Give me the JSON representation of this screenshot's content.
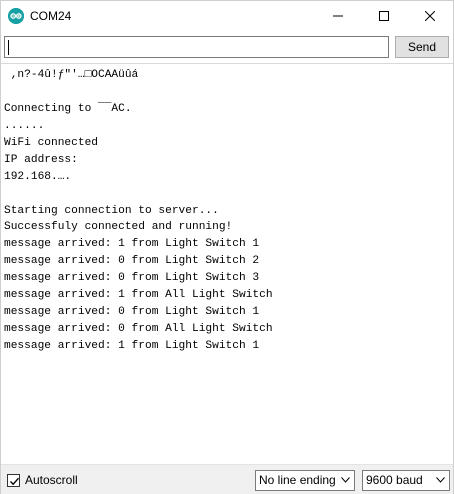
{
  "window": {
    "title": "COM24"
  },
  "input": {
    "value": "",
    "send_label": "Send"
  },
  "output": {
    "lines": [
      " ,n?-4û!ƒ\"'…□OCAAüûá",
      "",
      "Connecting to ¯¯AC.",
      "......",
      "WiFi connected",
      "IP address: ",
      "192.168.…. ",
      "",
      "Starting connection to server...",
      "Successfuly connected and running!",
      "message arrived: 1 from Light Switch 1",
      "message arrived: 0 from Light Switch 2",
      "message arrived: 0 from Light Switch 3",
      "message arrived: 1 from All Light Switch",
      "message arrived: 0 from Light Switch 1",
      "message arrived: 0 from All Light Switch",
      "message arrived: 1 from Light Switch 1"
    ]
  },
  "bottom": {
    "autoscroll_label": "Autoscroll",
    "autoscroll_checked": true,
    "line_ending": "No line ending",
    "baud_rate": "9600 baud"
  },
  "icons": {
    "app": "arduino-icon",
    "minimize": "minimize-icon",
    "maximize": "maximize-icon",
    "close": "close-icon",
    "check": "checkmark-icon",
    "dropdown": "chevron-down-icon"
  },
  "colors": {
    "app_icon": "#17a1a5",
    "bottom_bar": "#f0f0f0",
    "button_bg": "#e1e1e1"
  }
}
